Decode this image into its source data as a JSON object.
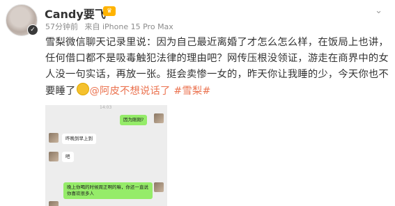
{
  "user": {
    "name": "Candy要飞",
    "badge_icon": "crown-badge-icon",
    "time": "57分钟前",
    "source": "来自 iPhone 15 Pro Max"
  },
  "post": {
    "text": "雪梨微信聊天记录里说：因为自己最近离婚了才怎么怎么样，在饭局上也讲，任何借口都不是吸毒触犯法律的理由吧？网传压根没领证，游走在商界中的女人没一句实话，再放一张。挺会卖惨一女的，昨天你让我睡的少，今天你也不要睡了",
    "mention": "@阿皮不想说话了",
    "hashtag": "#雪梨#"
  },
  "chat": {
    "time": "14:03",
    "messages": [
      {
        "side": "right",
        "text": "因为刚刚?"
      },
      {
        "side": "left",
        "text": "昨晚到早上到"
      },
      {
        "side": "left",
        "text": "吧"
      },
      {
        "side": "right",
        "text": "晚上你喝的时候周正啊的嘛，你还一直说你喜欢很多人"
      }
    ]
  }
}
